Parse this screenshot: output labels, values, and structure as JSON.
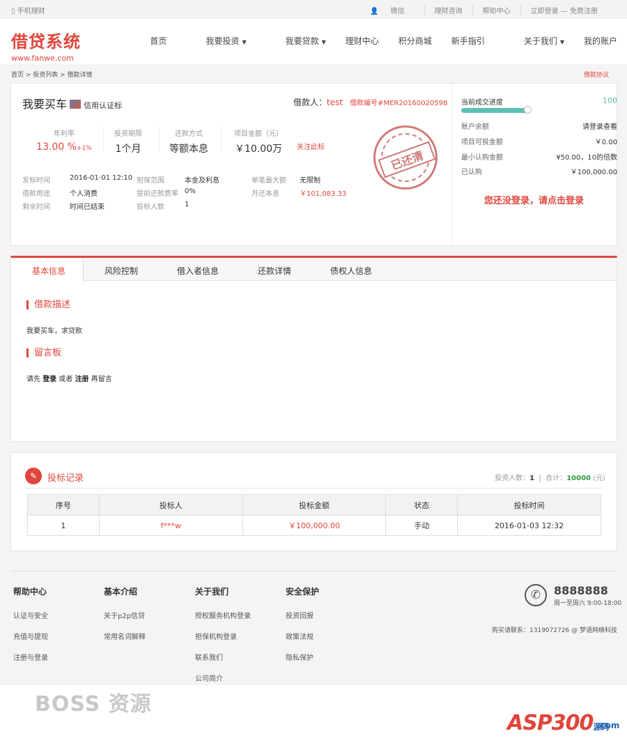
{
  "topbar": {
    "mobile": "手机理财",
    "wechat": "微信",
    "consult": "理财咨询",
    "help": "帮助中心",
    "auth": "立即登录 — 免费注册"
  },
  "logo": {
    "title": "借贷系统",
    "url": "www.fanwe.com"
  },
  "nav": [
    "首页",
    "我要投资",
    "我要贷款",
    "理财中心",
    "积分商城",
    "新手指引",
    "关于我们",
    "我的账户"
  ],
  "crumb": "首页 > 投资列表 > 借款详情",
  "agreement": "借款协议",
  "project": {
    "title": "我要买车",
    "credit": "信用认证标",
    "borrower_label": "借款人：",
    "borrower": "test",
    "number": "借款编号#MER20160020598",
    "rate_label": "年利率",
    "rate": "13.00 %",
    "rate_bonus": "+1%",
    "term_label": "投资期限",
    "term": "1个月",
    "repay_label": "还款方式",
    "repay": "等额本息",
    "amount_label": "项目金额（元）",
    "amount": "￥10.00万",
    "follow": "关注此标",
    "stamp": "已还清"
  },
  "details": {
    "publish_k": "发标时间",
    "publish_v": "2016-01-01 12:10",
    "use_k": "借款用途",
    "use_v": "个人消费",
    "remain_k": "剩余时间",
    "remain_v": "时间已结束",
    "guar_k": "担保范围",
    "guar_v": "本金及利息",
    "early_k": "提前还款费率",
    "early_v": "0%",
    "bidders_k": "投标人数",
    "bidders_v": "1",
    "max_k": "单笔最大额",
    "max_v": "无限制",
    "monthly_k": "月还本息",
    "monthly_v": "￥101,083.33"
  },
  "side": {
    "progress_label": "当前成交进度",
    "progress": "100",
    "progress_fraction": 1.0,
    "balance_k": "账户余额",
    "balance_v": "请登录查看",
    "investable_k": "项目可投金额",
    "investable_v": "￥0.00",
    "min_k": "最小认购金额",
    "min_v": "¥50.00，10的倍数",
    "subscribed_k": "已认购",
    "subscribed_v": "￥100,000.00",
    "login_hint": "您还没登录，请点击登录"
  },
  "tabs": [
    "基本信息",
    "风险控制",
    "借入者信息",
    "还款详情",
    "债权人信息"
  ],
  "basic": {
    "desc_title": "借款描述",
    "desc": "我要买车，求贷款",
    "board_title": "留言板",
    "board_pre": "请先",
    "board_login": "登录",
    "board_or": "或者",
    "board_reg": "注册",
    "board_post": "再留言"
  },
  "records": {
    "title": "投标记录",
    "count_label": "投资人数：",
    "count": "1",
    "total_label": "合计：",
    "total": "10000",
    "unit": "(元)",
    "headers": [
      "序号",
      "投标人",
      "投标金额",
      "状态",
      "投标时间"
    ],
    "rows": [
      [
        "1",
        "f***w",
        "￥100,000.00",
        "手动",
        "2016-01-03 12:32"
      ]
    ]
  },
  "footer": {
    "col1": {
      "title": "帮助中心",
      "items": [
        "认证与安全",
        "充值与提现",
        "注册与登录"
      ]
    },
    "col2": {
      "title": "基本介绍",
      "items": [
        "关于p2p信贷",
        "常用名词解释"
      ]
    },
    "col3": {
      "title": "关于我们",
      "items": [
        "授权服务机构登录",
        "担保机构登录",
        "联系我们",
        "公司简介"
      ]
    },
    "col4": {
      "title": "安全保护",
      "items": [
        "投资回报",
        "政策法规",
        "隐私保护"
      ]
    },
    "phone": "8888888",
    "hours": "周一至周六 9:00-18:00",
    "contact": "购买请联系：1319072726 @ 梦语网络科技"
  },
  "watermarks": {
    "boss": "BOSS 资源",
    "asp": "ASP300",
    "asp_cn": "源码",
    "com": ".com"
  }
}
